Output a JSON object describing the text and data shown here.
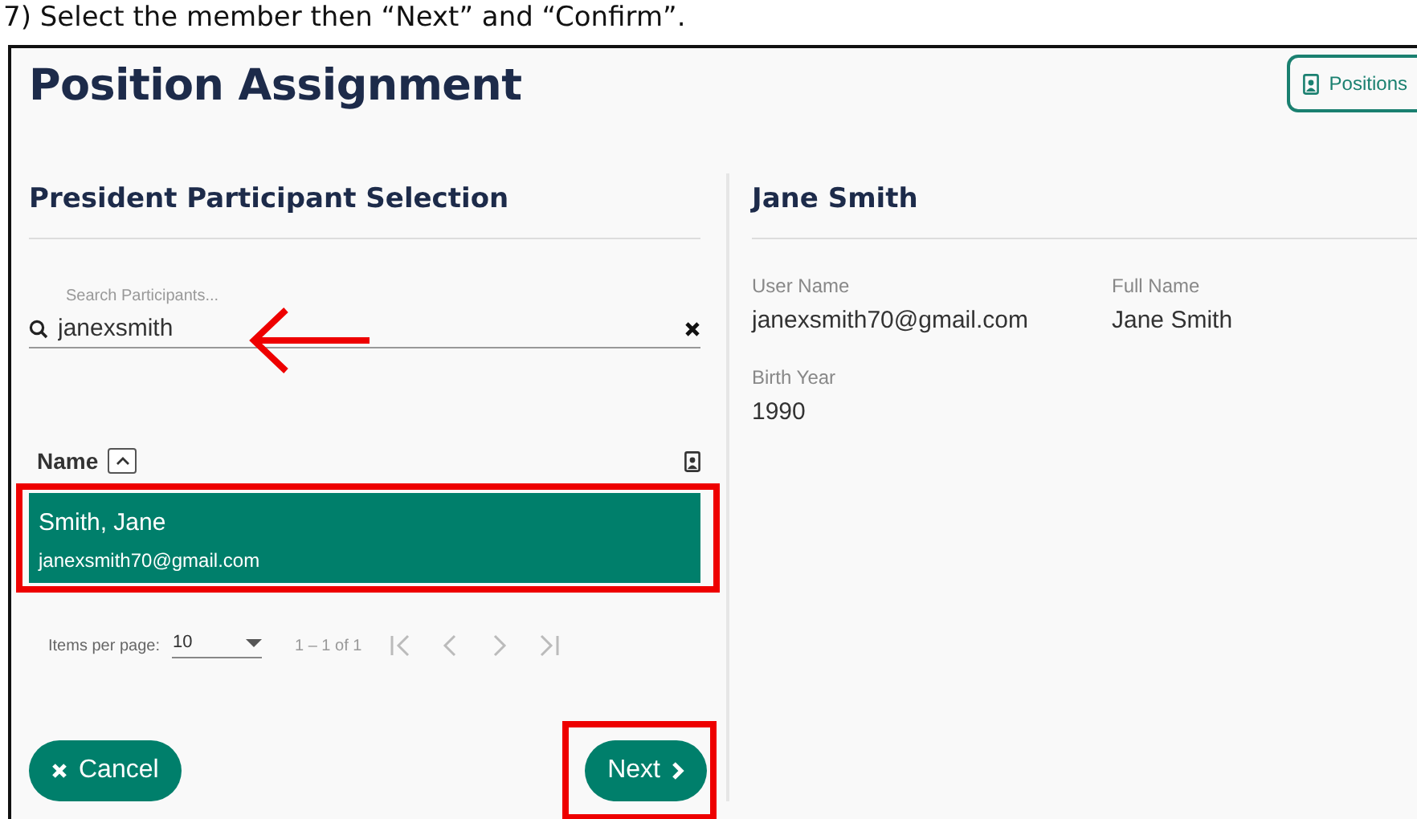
{
  "caption": "7) Select the member then “Next” and “Confirm”.",
  "page": {
    "title": "Position Assignment",
    "positions_button": "Positions"
  },
  "selection": {
    "heading": "President Participant Selection",
    "search": {
      "placeholder": "Search Participants...",
      "value": "janexsmith",
      "pointed": true
    },
    "table": {
      "column": "Name",
      "sort_ascending": true,
      "rows": [
        {
          "name": "Smith, Jane",
          "email": "janexsmith70@gmail.com",
          "selected": true,
          "highlighted": true
        }
      ]
    },
    "paginator": {
      "label": "Items per page:",
      "page_size": "10",
      "range": "1 – 1 of 1"
    },
    "cancel": "Cancel",
    "next": {
      "label": "Next",
      "highlighted": true
    }
  },
  "details": {
    "heading": "Jane Smith",
    "fields": [
      {
        "label": "User Name",
        "value": "janexsmith70@gmail.com"
      },
      {
        "label": "Full Name",
        "value": "Jane Smith"
      },
      {
        "label": "Birth Year",
        "value": "1990"
      }
    ]
  }
}
